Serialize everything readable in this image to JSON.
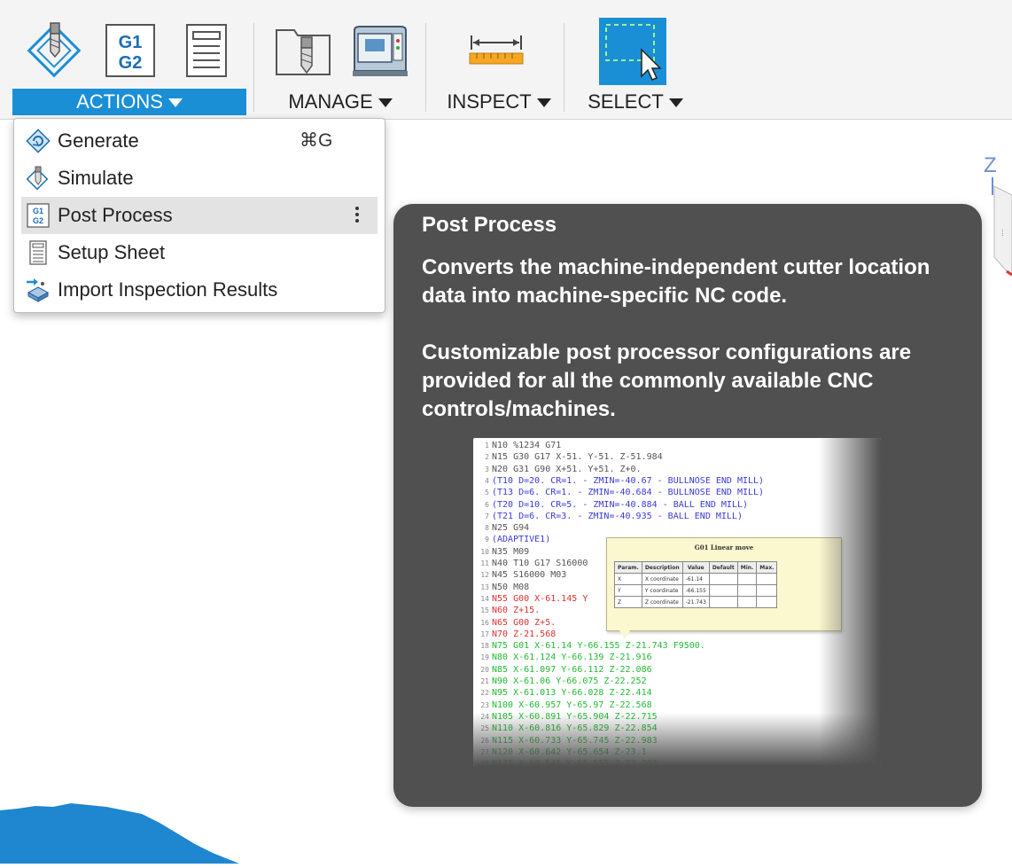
{
  "toolbar": {
    "groups": [
      {
        "label": "ACTIONS",
        "active": true
      },
      {
        "label": "MANAGE",
        "active": false
      },
      {
        "label": "INSPECT",
        "active": false
      },
      {
        "label": "SELECT",
        "active": false
      }
    ],
    "g1g2_icon_text": [
      "G1",
      "G2"
    ]
  },
  "dropdown": {
    "items": [
      {
        "label": "Generate",
        "shortcut": "⌘G",
        "icon": "generate-icon"
      },
      {
        "label": "Simulate",
        "shortcut": "",
        "icon": "simulate-icon"
      },
      {
        "label": "Post Process",
        "shortcut": "",
        "icon": "g1g2-icon",
        "highlighted": true
      },
      {
        "label": "Setup Sheet",
        "shortcut": "",
        "icon": "setup-sheet-icon"
      },
      {
        "label": "Import Inspection Results",
        "shortcut": "",
        "icon": "import-inspection-icon"
      }
    ]
  },
  "tooltip": {
    "title": "Post Process",
    "paragraph1": "Converts the machine-independent cutter location data into machine-specific NC code.",
    "paragraph2": "Customizable post processor configurations are provided for all the commonly available CNC controls/machines.",
    "code_lines": [
      {
        "n": "1",
        "text": "N10 %1234 G71",
        "color": "default"
      },
      {
        "n": "2",
        "text": "N15 G30 G17 X-51. Y-51. Z-51.984",
        "color": "default"
      },
      {
        "n": "3",
        "text": "N20 G31 G90 X+51. Y+51. Z+0.",
        "color": "default"
      },
      {
        "n": "4",
        "text": "(T10  D=20. CR=1. - ZMIN=-40.67 - BULLNOSE END MILL)",
        "color": "blue"
      },
      {
        "n": "5",
        "text": "(T13  D=6. CR=1. - ZMIN=-40.684 - BULLNOSE END MILL)",
        "color": "blue"
      },
      {
        "n": "6",
        "text": "(T20  D=10. CR=5. - ZMIN=-40.884 - BALL END MILL)",
        "color": "blue"
      },
      {
        "n": "7",
        "text": "(T21  D=6. CR=3. - ZMIN=-40.935 - BALL END MILL)",
        "color": "blue"
      },
      {
        "n": "8",
        "text": "N25 G94",
        "color": "default"
      },
      {
        "n": "9",
        "text": "(ADAPTIVE1)",
        "color": "blue"
      },
      {
        "n": "10",
        "text": "N35 M09",
        "color": "default"
      },
      {
        "n": "11",
        "text": "N40 T10 G17 S16000",
        "color": "default"
      },
      {
        "n": "12",
        "text": "N45 S16000 M03",
        "color": "default"
      },
      {
        "n": "13",
        "text": "N50 M08",
        "color": "default"
      },
      {
        "n": "14",
        "text": "N55 G00 X-61.145 Y",
        "color": "red"
      },
      {
        "n": "15",
        "text": "N60 Z+15.",
        "color": "red"
      },
      {
        "n": "16",
        "text": "N65 G00 Z+5.",
        "color": "red"
      },
      {
        "n": "17",
        "text": "N70 Z-21.568",
        "color": "red"
      },
      {
        "n": "18",
        "text": "N75 G01 X-61.14 Y-66.155 Z-21.743 F9500.",
        "color": "green"
      },
      {
        "n": "19",
        "text": "N80 X-61.124 Y-66.139 Z-21.916",
        "color": "green"
      },
      {
        "n": "20",
        "text": "N85 X-61.097 Y-66.112 Z-22.086",
        "color": "green"
      },
      {
        "n": "21",
        "text": "N90 X-61.06 Y-66.075 Z-22.252",
        "color": "green"
      },
      {
        "n": "22",
        "text": "N95 X-61.013 Y-66.028 Z-22.414",
        "color": "green"
      },
      {
        "n": "23",
        "text": "N100 X-60.957 Y-65.97 Z-22.568",
        "color": "green"
      },
      {
        "n": "24",
        "text": "N105 X-60.891 Y-65.904 Z-22.715",
        "color": "green"
      },
      {
        "n": "25",
        "text": "N110 X-60.816 Y-65.829 Z-22.854",
        "color": "green"
      },
      {
        "n": "26",
        "text": "N115 X-60.733 Y-65.745 Z-22.983",
        "color": "green"
      },
      {
        "n": "27",
        "text": "N120 X-60.642 Y-65.654 Z-23.1",
        "color": "green"
      },
      {
        "n": "28",
        "text": "N125 X-60.545 Y-65.555 Z-23.203",
        "color": "green"
      }
    ],
    "popup": {
      "title": "G01 Linear move",
      "headers": [
        "Param.",
        "Description",
        "Value",
        "Default",
        "Min.",
        "Max."
      ],
      "rows": [
        [
          "X",
          "X coordinate",
          "-61.14",
          "",
          "",
          ""
        ],
        [
          "Y",
          "Y coordinate",
          "-66.155",
          "",
          "",
          ""
        ],
        [
          "Z",
          "Z coordinate",
          "-21.743",
          "",
          "",
          ""
        ]
      ]
    }
  },
  "viewcube": {
    "axis_label": "Z"
  },
  "colors": {
    "accent": "#1a8fd6",
    "tooltip_bg": "#505050",
    "toolbar_bg": "#f4f4f4",
    "menu_highlight": "#e3e3e3",
    "code_blue": "#3a3ad8",
    "code_red": "#e03030",
    "code_green": "#22bb33",
    "terrain": "#1f86d0"
  }
}
